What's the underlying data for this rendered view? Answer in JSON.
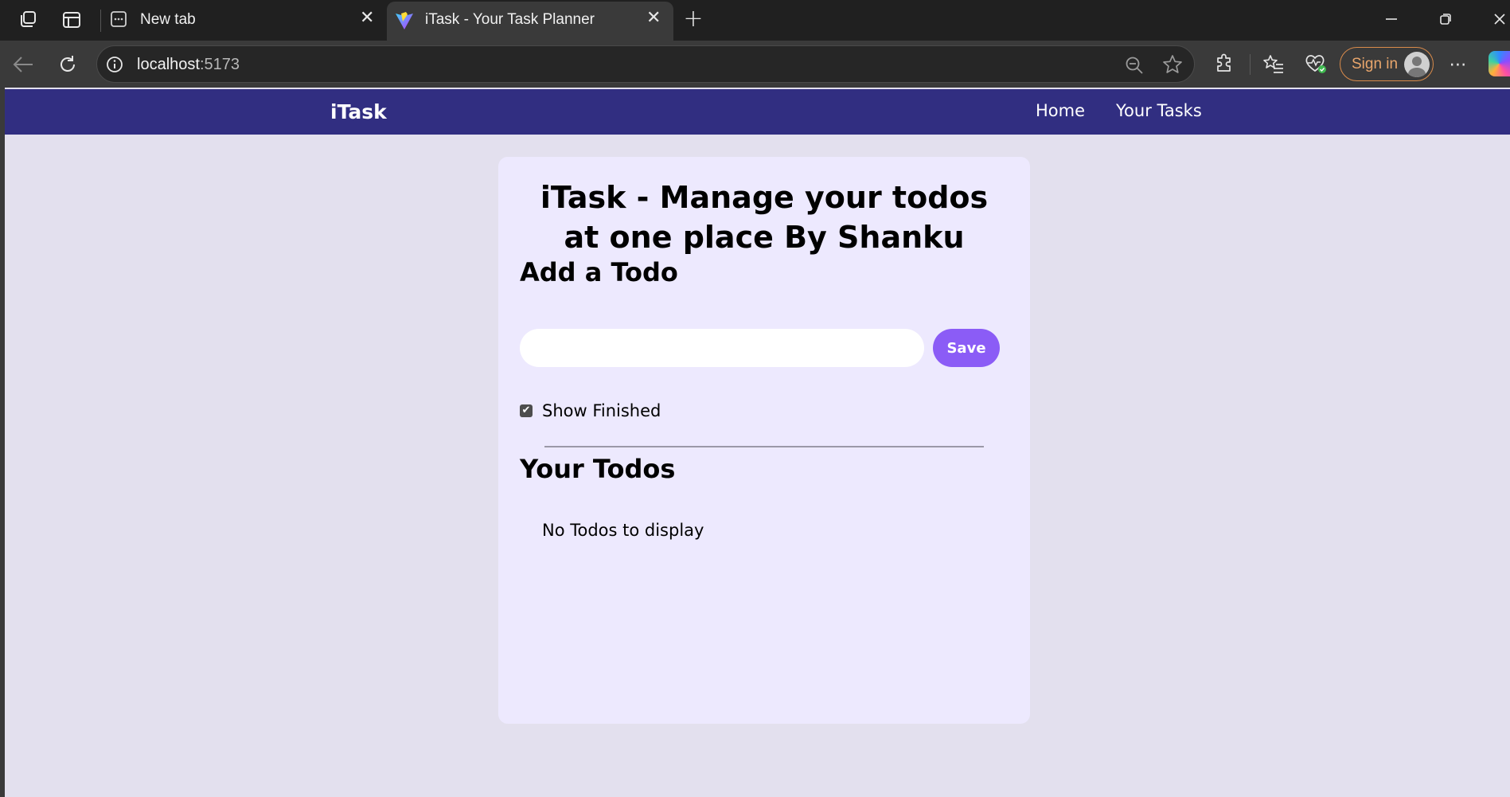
{
  "browser": {
    "tabs": [
      {
        "title": "New tab",
        "icon": "new-tab-page-icon",
        "active": false
      },
      {
        "title": "iTask - Your Task Planner",
        "icon": "vite-favicon-icon",
        "active": true
      }
    ],
    "address": {
      "host": "localhost",
      "port": ":5173"
    },
    "signin_label": "Sign in",
    "colors": {
      "tabstrip": "#202020",
      "toolbar": "#3a3a3a",
      "signin_accent": "#d98b4b"
    }
  },
  "app": {
    "brand": "iTask",
    "nav": {
      "home": "Home",
      "tasks": "Your Tasks"
    },
    "title": "iTask - Manage your todos at one place By Shanku",
    "add_heading": "Add a Todo",
    "input": {
      "value": "",
      "placeholder": ""
    },
    "save_label": "Save",
    "show_finished": {
      "label": "Show Finished",
      "checked": true
    },
    "todos_heading": "Your Todos",
    "empty_message": "No Todos to display",
    "colors": {
      "navbar": "#312e81",
      "page_bg": "#e3e0ee",
      "card_bg": "#ede9fe",
      "save_button": "#8b5cf6"
    }
  }
}
